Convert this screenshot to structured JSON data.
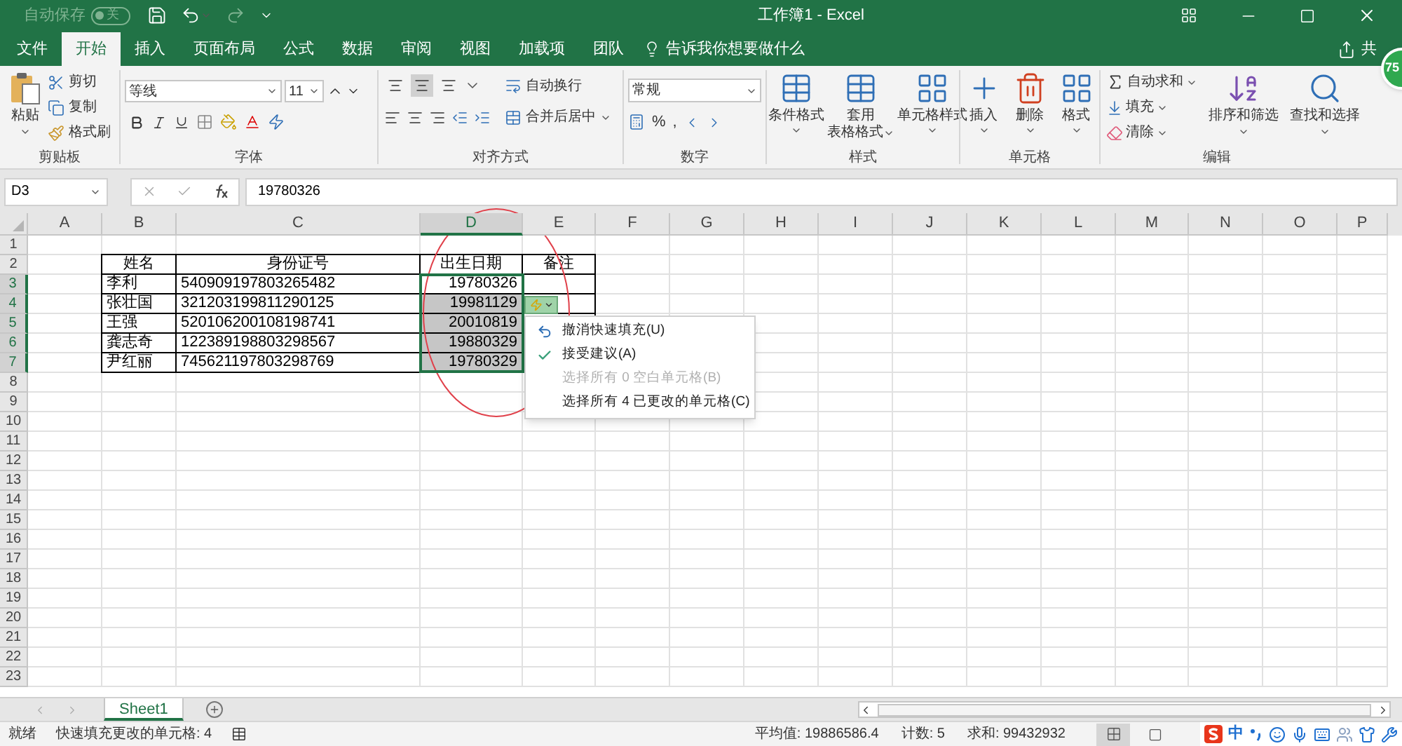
{
  "title_bar": {
    "autosave": {
      "label": "自动保存",
      "state": "关",
      "on": false
    },
    "title": "工作簿1 - Excel"
  },
  "menu_tabs": [
    {
      "label": "文件",
      "selected": false
    },
    {
      "label": "开始",
      "selected": true
    },
    {
      "label": "插入",
      "selected": false
    },
    {
      "label": "页面布局",
      "selected": false
    },
    {
      "label": "公式",
      "selected": false
    },
    {
      "label": "数据",
      "selected": false
    },
    {
      "label": "审阅",
      "selected": false
    },
    {
      "label": "视图",
      "selected": false
    },
    {
      "label": "加载项",
      "selected": false
    },
    {
      "label": "团队",
      "selected": false
    }
  ],
  "tell_me": "告诉我你想要做什么",
  "share": "共",
  "clipboard": {
    "label": "剪贴板",
    "paste": "粘贴",
    "cut": "剪切",
    "copy": "复制",
    "format_painter": "格式刷"
  },
  "font": {
    "label": "字体",
    "name": "等线",
    "size": "11"
  },
  "alignment": {
    "label": "对齐方式",
    "wrap_text": "自动换行",
    "merge_center": "合并后居中",
    "vertical": [
      {
        "selected": false
      },
      {
        "selected": true
      },
      {
        "selected": false
      }
    ]
  },
  "number": {
    "label": "数字",
    "format": "常规",
    "percent": "%",
    "comma": ","
  },
  "styles": {
    "label": "样式",
    "buttons": [
      {
        "lines": [
          "条件格式"
        ]
      },
      {
        "lines": [
          "套用",
          "表格格式"
        ]
      },
      {
        "lines": [
          "单元格样式"
        ]
      }
    ]
  },
  "cells": {
    "label": "单元格",
    "buttons": [
      "插入",
      "删除",
      "格式"
    ]
  },
  "editing": {
    "label": "编辑",
    "autosum": "自动求和",
    "fill": "填充",
    "clear": "清除",
    "sort_filter": "排序和筛选",
    "find_select": "查找和选择"
  },
  "formula_bar": {
    "name_box": "D3",
    "formula": "19780326"
  },
  "columns": [
    {
      "label": "A",
      "selected": false
    },
    {
      "label": "B",
      "selected": false
    },
    {
      "label": "C",
      "selected": false
    },
    {
      "label": "D",
      "selected": true
    },
    {
      "label": "E",
      "selected": false
    },
    {
      "label": "F",
      "selected": false
    },
    {
      "label": "G",
      "selected": false
    },
    {
      "label": "H",
      "selected": false
    },
    {
      "label": "I",
      "selected": false
    },
    {
      "label": "J",
      "selected": false
    },
    {
      "label": "K",
      "selected": false
    },
    {
      "label": "L",
      "selected": false
    },
    {
      "label": "M",
      "selected": false
    },
    {
      "label": "N",
      "selected": false
    },
    {
      "label": "O",
      "selected": false
    },
    {
      "label": "P",
      "selected": false
    }
  ],
  "rows": [
    {
      "label": "1",
      "selected": false
    },
    {
      "label": "2",
      "selected": false
    },
    {
      "label": "3",
      "selected": true
    },
    {
      "label": "4",
      "selected": true
    },
    {
      "label": "5",
      "selected": true
    },
    {
      "label": "6",
      "selected": true
    },
    {
      "label": "7",
      "selected": true
    },
    {
      "label": "8",
      "selected": false
    },
    {
      "label": "9",
      "selected": false
    },
    {
      "label": "10",
      "selected": false
    },
    {
      "label": "11",
      "selected": false
    },
    {
      "label": "12",
      "selected": false
    },
    {
      "label": "13",
      "selected": false
    },
    {
      "label": "14",
      "selected": false
    },
    {
      "label": "15",
      "selected": false
    },
    {
      "label": "16",
      "selected": false
    },
    {
      "label": "17",
      "selected": false
    },
    {
      "label": "18",
      "selected": false
    },
    {
      "label": "19",
      "selected": false
    },
    {
      "label": "20",
      "selected": false
    },
    {
      "label": "21",
      "selected": false
    },
    {
      "label": "22",
      "selected": false
    },
    {
      "label": "23",
      "selected": false
    }
  ],
  "table": {
    "header": [
      "姓名",
      "身份证号",
      "出生日期",
      "备注"
    ],
    "rows": [
      {
        "name": "李利",
        "id_number": "540909197803265482",
        "birth_date": "19780326",
        "selected": true,
        "flash_filled": false
      },
      {
        "name": "张壮国",
        "id_number": "321203199811290125",
        "birth_date": "19981129",
        "selected": true,
        "flash_filled": true
      },
      {
        "name": "王强",
        "id_number": "520106200108198741",
        "birth_date": "20010819",
        "selected": true,
        "flash_filled": true
      },
      {
        "name": "龚志奇",
        "id_number": "122389198803298567",
        "birth_date": "19880329",
        "selected": true,
        "flash_filled": true
      },
      {
        "name": "尹红丽",
        "id_number": "745621197803298769",
        "birth_date": "19780329",
        "selected": true,
        "flash_filled": true
      }
    ]
  },
  "flash_fill_menu": [
    {
      "label": "撤消快速填充(U)",
      "kind": "undo",
      "disabled": false
    },
    {
      "label": "接受建议(A)",
      "kind": "accept",
      "disabled": false
    },
    {
      "label": "选择所有 0 空白单元格(B)",
      "kind": "plain",
      "disabled": true
    },
    {
      "label": "选择所有 4 已更改的单元格(C)",
      "kind": "plain",
      "disabled": false
    }
  ],
  "sheet_tabs": [
    {
      "label": "Sheet1",
      "selected": true
    }
  ],
  "status_bar": {
    "mode": "就绪",
    "message": "快速填充更改的单元格: 4",
    "average": "平均值: 19886586.4",
    "count": "计数: 5",
    "sum": "求和: 99432932",
    "ime_mode": "中"
  },
  "badge": "75"
}
